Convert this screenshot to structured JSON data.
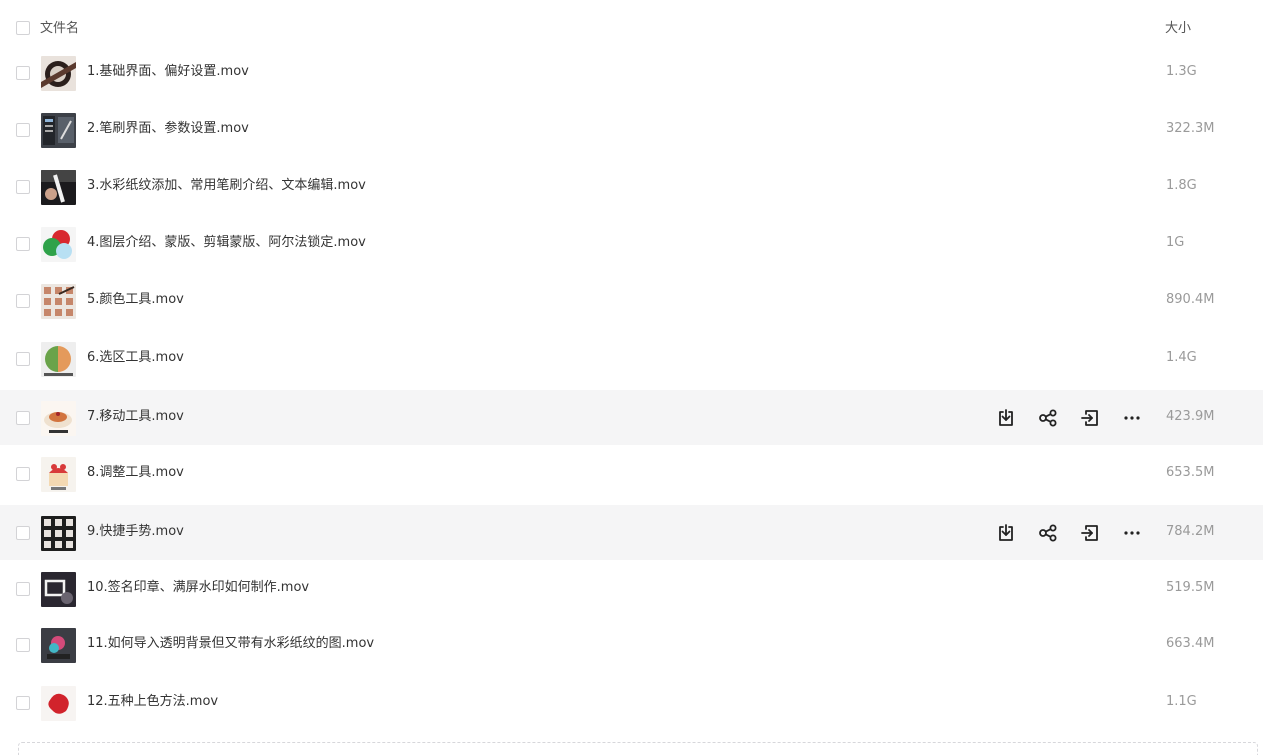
{
  "header": {
    "name_label": "文件名",
    "size_label": "大小"
  },
  "files": [
    {
      "name": "1.基础界面、偏好设置.mov",
      "size": "1.3G",
      "thumb": "thumb-brush-hand"
    },
    {
      "name": "2.笔刷界面、参数设置.mov",
      "size": "322.3M",
      "thumb": "thumb-brush-panel"
    },
    {
      "name": "3.水彩纸纹添加、常用笔刷介绍、文本编辑.mov",
      "size": "1.8G",
      "thumb": "thumb-pencil"
    },
    {
      "name": "4.图层介绍、蒙版、剪辑蒙版、阿尔法锁定.mov",
      "size": "1G",
      "thumb": "thumb-color-circles"
    },
    {
      "name": "5.颜色工具.mov",
      "size": "890.4M",
      "thumb": "thumb-color-grid"
    },
    {
      "name": "6.选区工具.mov",
      "size": "1.4G",
      "thumb": "thumb-selection"
    },
    {
      "name": "7.移动工具.mov",
      "size": "423.9M",
      "thumb": "thumb-dessert"
    },
    {
      "name": "8.调整工具.mov",
      "size": "653.5M",
      "thumb": "thumb-cake"
    },
    {
      "name": "9.快捷手势.mov",
      "size": "784.2M",
      "thumb": "thumb-gesture-grid"
    },
    {
      "name": "10.签名印章、满屏水印如何制作.mov",
      "size": "519.5M",
      "thumb": "thumb-stamp"
    },
    {
      "name": "11.如何导入透明背景但又带有水彩纸纹的图.mov",
      "size": "663.4M",
      "thumb": "thumb-transparent"
    },
    {
      "name": "12.五种上色方法.mov",
      "size": "1.1G",
      "thumb": "thumb-red-flower"
    }
  ],
  "row_actions": [
    {
      "icon": "download-icon"
    },
    {
      "icon": "share-icon"
    },
    {
      "icon": "move-to-icon"
    },
    {
      "icon": "more-icon"
    }
  ],
  "hovered_rows": [
    6,
    8
  ],
  "colors": {
    "hover_bg": "#f5f5f6",
    "size_text": "#9a9a9a",
    "name_text": "#333333"
  }
}
